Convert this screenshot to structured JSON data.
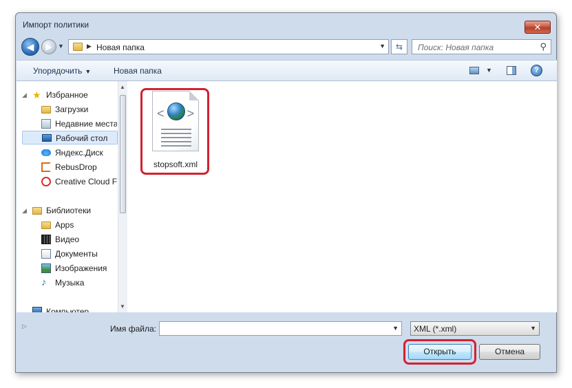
{
  "window": {
    "title": "Импорт политики",
    "close_glyph": "✕"
  },
  "address": {
    "path": "Новая папка",
    "search_placeholder": "Поиск: Новая папка"
  },
  "toolbar": {
    "organize_label": "Упорядочить",
    "new_folder_label": "Новая папка",
    "help_glyph": "?"
  },
  "sidebar": {
    "items": [
      {
        "label": "Избранное",
        "icon": "star-icon"
      },
      {
        "label": "Загрузки",
        "icon": "downloads-folder-icon"
      },
      {
        "label": "Недавние места",
        "icon": "recent-places-icon"
      },
      {
        "label": "Рабочий стол",
        "icon": "desktop-icon",
        "selected": true
      },
      {
        "label": "Яндекс.Диск",
        "icon": "yandex-disk-icon"
      },
      {
        "label": "RebusDrop",
        "icon": "rebusdrop-icon"
      },
      {
        "label": "Creative Cloud Fi",
        "icon": "creative-cloud-icon"
      },
      {
        "label": "Библиотеки",
        "icon": "libraries-icon"
      },
      {
        "label": "Apps",
        "icon": "folder-icon"
      },
      {
        "label": "Видео",
        "icon": "video-icon"
      },
      {
        "label": "Документы",
        "icon": "documents-icon"
      },
      {
        "label": "Изображения",
        "icon": "images-icon"
      },
      {
        "label": "Музыка",
        "icon": "music-icon"
      },
      {
        "label": "Компьютер",
        "icon": "computer-icon"
      }
    ]
  },
  "files": [
    {
      "name": "stopsoft.xml",
      "icon": "xml-file-icon"
    }
  ],
  "bottom": {
    "filename_label": "Имя файла:",
    "filename_value": "",
    "filter_value": "XML (*.xml)",
    "open_label": "Открыть",
    "cancel_label": "Отмена"
  },
  "colors": {
    "highlight": "#d32030",
    "window_frame": "#cfdcec",
    "selection": "#dcebfc"
  }
}
